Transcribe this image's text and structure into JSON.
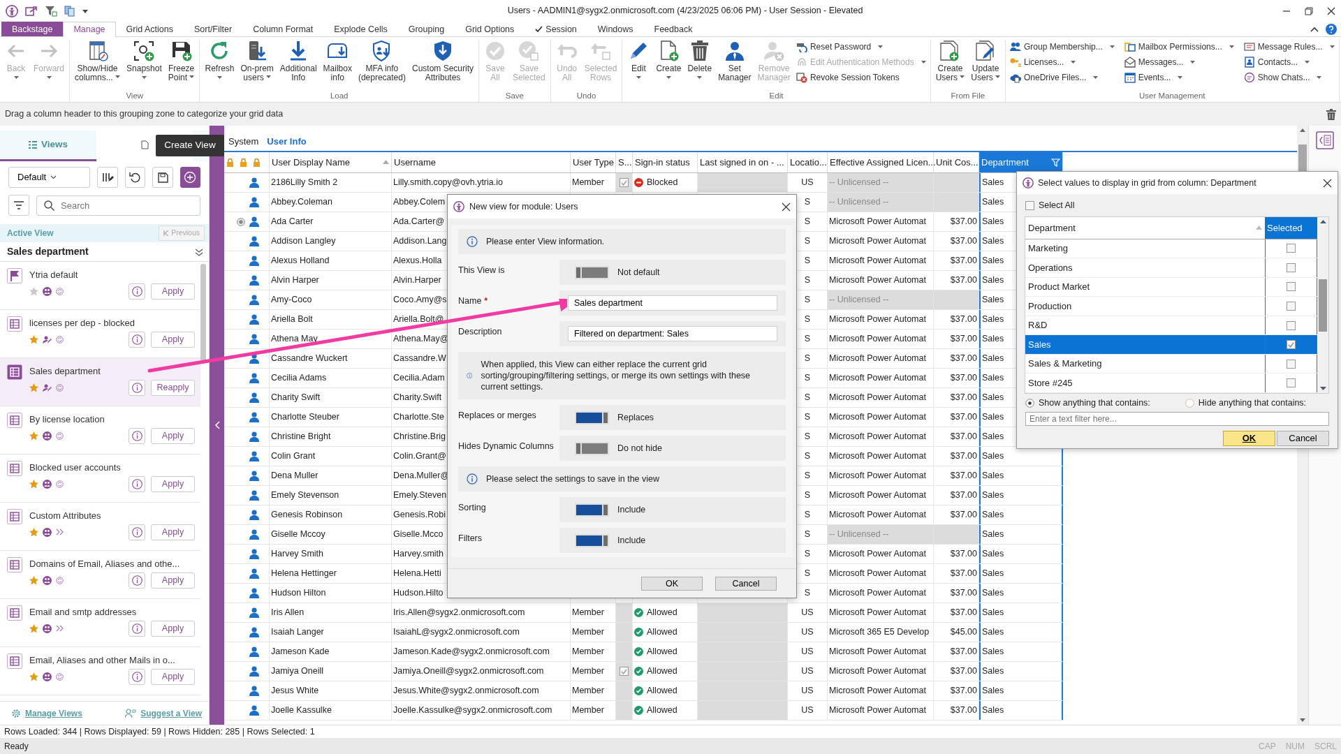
{
  "title_bar": {
    "title": "Users - AADMIN1@sygx2.onmicrosoft.com (4/23/2025 06:06 PM) - User Session - Elevated"
  },
  "menu_tabs": [
    {
      "label": "Backstage",
      "kind": "backstage",
      "selected": false,
      "checked": false
    },
    {
      "label": "Manage",
      "kind": "tab",
      "selected": true,
      "checked": false
    },
    {
      "label": "Grid Actions",
      "kind": "tab",
      "selected": false,
      "checked": false
    },
    {
      "label": "Sort/Filter",
      "kind": "tab",
      "selected": false,
      "checked": false
    },
    {
      "label": "Column Format",
      "kind": "tab",
      "selected": false,
      "checked": false
    },
    {
      "label": "Explode Cells",
      "kind": "tab",
      "selected": false,
      "checked": false
    },
    {
      "label": "Grouping",
      "kind": "tab",
      "selected": false,
      "checked": false
    },
    {
      "label": "Grid Options",
      "kind": "tab",
      "selected": false,
      "checked": false
    },
    {
      "label": "Session",
      "kind": "tab",
      "selected": false,
      "checked": true
    },
    {
      "label": "Windows",
      "kind": "tab",
      "selected": false,
      "checked": false
    },
    {
      "label": "Feedback",
      "kind": "tab",
      "selected": false,
      "checked": false
    }
  ],
  "ribbon": {
    "groups": [
      {
        "buttons": [
          {
            "lines": [
              "Back"
            ],
            "menu": true,
            "disabled": true
          },
          {
            "lines": [
              "Forward"
            ],
            "menu": true,
            "disabled": true
          }
        ]
      },
      {
        "label": "View",
        "buttons": [
          {
            "lines": [
              "Show/Hide",
              "columns..."
            ],
            "menu": true,
            "disabled": false
          },
          {
            "lines": [
              "Snapshot"
            ],
            "menu": true,
            "disabled": false
          },
          {
            "lines": [
              "Freeze",
              "Point"
            ],
            "menu": true,
            "disabled": false
          }
        ]
      },
      {
        "label": "Load",
        "buttons": [
          {
            "lines": [
              "Refresh"
            ],
            "menu": true,
            "disabled": false
          },
          {
            "lines": [
              "On-prem",
              "users"
            ],
            "menu": true,
            "disabled": false
          },
          {
            "lines": [
              "Additional",
              "Info"
            ],
            "menu": false,
            "disabled": false
          },
          {
            "lines": [
              "Mailbox",
              "info"
            ],
            "menu": false,
            "disabled": false
          },
          {
            "lines": [
              "MFA info",
              "(deprecated)"
            ],
            "menu": false,
            "disabled": false
          },
          {
            "lines": [
              "Custom Security",
              "Attributes"
            ],
            "menu": false,
            "disabled": false
          }
        ]
      },
      {
        "label": "Save",
        "buttons": [
          {
            "lines": [
              "Save",
              "All"
            ],
            "menu": false,
            "disabled": true
          },
          {
            "lines": [
              "Save",
              "Selected"
            ],
            "menu": false,
            "disabled": true
          }
        ]
      },
      {
        "label": "Undo",
        "buttons": [
          {
            "lines": [
              "Undo",
              "All"
            ],
            "menu": false,
            "disabled": true
          },
          {
            "lines": [
              "Selected",
              "Rows"
            ],
            "menu": false,
            "disabled": true
          }
        ]
      },
      {
        "label": "Edit",
        "buttons": [
          {
            "lines": [
              "Edit"
            ],
            "menu": true,
            "disabled": false
          },
          {
            "lines": [
              "Create"
            ],
            "menu": true,
            "disabled": false
          },
          {
            "lines": [
              "Delete"
            ],
            "menu": true,
            "disabled": false
          },
          {
            "lines": [
              "Set",
              "Manager"
            ],
            "menu": false,
            "disabled": false
          },
          {
            "lines": [
              "Remove",
              "Manager"
            ],
            "menu": false,
            "disabled": true
          }
        ],
        "small": [
          {
            "label": "Reset Password",
            "menu": true,
            "disabled": false
          },
          {
            "label": "Edit Authentication Methods",
            "menu": true,
            "disabled": true
          },
          {
            "label": "Revoke Session Tokens",
            "menu": false,
            "disabled": false
          }
        ]
      },
      {
        "label": "From File",
        "buttons": [
          {
            "lines": [
              "Create",
              "Users"
            ],
            "menu": true,
            "disabled": false
          },
          {
            "lines": [
              "Update",
              "Users"
            ],
            "menu": true,
            "disabled": false
          }
        ]
      },
      {
        "label": "User Management",
        "small": [
          {
            "label": "Group Membership...",
            "menu": true,
            "disabled": false
          },
          {
            "label": "Licenses...",
            "menu": true,
            "disabled": false
          },
          {
            "label": "OneDrive Files...",
            "menu": true,
            "disabled": false
          },
          {
            "label": "Mailbox Permissions...",
            "menu": true,
            "disabled": false
          },
          {
            "label": "Messages...",
            "menu": true,
            "disabled": false
          },
          {
            "label": "Events...",
            "menu": true,
            "disabled": false
          },
          {
            "label": "Message Rules...",
            "menu": true,
            "disabled": false
          },
          {
            "label": "Contacts...",
            "menu": true,
            "disabled": false
          },
          {
            "label": "Show Chats...",
            "menu": true,
            "disabled": false
          }
        ]
      }
    ]
  },
  "grouping_zone": {
    "text": "Drag a column header to this grouping zone to categorize your grid data"
  },
  "views_panel": {
    "tabs": [
      {
        "label": "Views",
        "selected": true
      },
      {
        "selected": false
      }
    ],
    "view_selector": "Default",
    "search_placeholder": "Search",
    "active_view_label": "Active View",
    "previous_button": {
      "label": "Previous",
      "disabled": true
    },
    "active_view": "Sales department",
    "items": [
      {
        "title": "Ytria default",
        "kind": "system",
        "favorite": false,
        "shared": true,
        "synced": true,
        "button": "Apply",
        "selected": false
      },
      {
        "title": "licenses per dep - blocked",
        "kind": "custom",
        "favorite": true,
        "shared": false,
        "synced": true,
        "button": "Apply",
        "selected": false
      },
      {
        "title": "Sales department",
        "kind": "custom",
        "favorite": true,
        "shared": false,
        "synced": true,
        "button": "Reapply",
        "selected": true
      },
      {
        "title": "By license location",
        "kind": "custom",
        "favorite": true,
        "shared": true,
        "synced": true,
        "button": "Apply",
        "selected": false
      },
      {
        "title": "Blocked user accounts",
        "kind": "custom",
        "favorite": true,
        "shared": true,
        "synced": true,
        "button": "Apply",
        "selected": false
      },
      {
        "title": "Custom Attributes",
        "kind": "custom",
        "favorite": true,
        "shared": true,
        "synced": false,
        "button": "Apply",
        "selected": false
      },
      {
        "title": "Domains of Email, Aliases and othe...",
        "kind": "custom",
        "favorite": true,
        "shared": true,
        "synced": true,
        "button": "Apply",
        "selected": false
      },
      {
        "title": "Email and smtp addresses",
        "kind": "custom",
        "favorite": true,
        "shared": true,
        "synced": false,
        "button": "Apply",
        "selected": false
      },
      {
        "title": "Email, Aliases and other Mails in o...",
        "kind": "custom",
        "favorite": true,
        "shared": true,
        "synced": true,
        "button": "Apply",
        "selected": false
      }
    ],
    "footer": [
      "Manage Views",
      "Suggest a View"
    ]
  },
  "tooltip": {
    "text": "Create View"
  },
  "grid": {
    "tabs": [
      {
        "label": "System",
        "selected": false
      },
      {
        "label": "User Info",
        "selected": true
      }
    ],
    "columns": [
      {
        "label": "User Display Name",
        "sorted": true,
        "filtered": false
      },
      {
        "label": "Username",
        "sorted": false,
        "filtered": false
      },
      {
        "label": "User Type",
        "sorted": false,
        "filtered": false
      },
      {
        "label": "S...",
        "sorted": false,
        "filtered": false
      },
      {
        "label": "Sign-in status",
        "sorted": false,
        "filtered": false
      },
      {
        "label": "Last signed in on - ...",
        "sorted": false,
        "filtered": false
      },
      {
        "label": "Locatio...",
        "sorted": false,
        "filtered": false
      },
      {
        "label": "Effective Assigned Licen...",
        "sorted": false,
        "filtered": false
      },
      {
        "label": "Unit Cos...",
        "sorted": false,
        "filtered": false
      },
      {
        "label": "Department",
        "sorted": false,
        "filtered": true
      }
    ],
    "rows": [
      {
        "name": "2186Lilly Smith 2",
        "username": "Lilly.smith.copy@ovh.ytria.io",
        "user_type": "Member",
        "s_checked": true,
        "sign_in": "Blocked",
        "blocked": true,
        "location": "US",
        "license": "-- Unlicensed --",
        "unlicensed": true,
        "department": "Sales",
        "selected": false
      },
      {
        "name": "Abbey.Coleman",
        "username": "Abbey.Colem",
        "location": "S",
        "license": "-- Unlicensed --",
        "unlicensed": true,
        "department": "Sales",
        "selected": false
      },
      {
        "name": "Ada Carter",
        "username": "Ada.Carter@",
        "location": "S",
        "license": "Microsoft Power Automat",
        "unit_cost": "$37.00",
        "unlicensed": false,
        "department": "Sales",
        "selected": true
      },
      {
        "name": "Addison Langley",
        "username": "Addison.Lang",
        "location": "S",
        "license": "Microsoft Power Automat",
        "unit_cost": "$37.00",
        "unlicensed": false,
        "department": "Sales",
        "selected": false
      },
      {
        "name": "Alexus Holland",
        "username": "Alexus.Holla",
        "location": "S",
        "license": "Microsoft Power Automat",
        "unit_cost": "$37.00",
        "unlicensed": false,
        "department": "Sales",
        "selected": false
      },
      {
        "name": "Alvin Harper",
        "username": "Alvin.Harper",
        "location": "S",
        "license": "Microsoft Power Automat",
        "unit_cost": "$37.00",
        "unlicensed": false,
        "department": "Sales",
        "selected": false
      },
      {
        "name": "Amy-Coco",
        "username": "Coco.Amy@s",
        "location": "S",
        "license": "-- Unlicensed --",
        "unlicensed": true,
        "department": "Sales",
        "selected": false
      },
      {
        "name": "Ariella Bolt",
        "username": "Ariella.Bolt@",
        "location": "S",
        "license": "Microsoft Power Automat",
        "unit_cost": "$37.00",
        "unlicensed": false,
        "department": "Sales",
        "selected": false
      },
      {
        "name": "Athena May",
        "username": "Athena.May@",
        "location": "S",
        "license": "Microsoft Power Automat",
        "unit_cost": "$37.00",
        "unlicensed": false,
        "department": "Sales",
        "selected": false
      },
      {
        "name": "Cassandre Wuckert",
        "username": "Cassandre.W",
        "location": "S",
        "license": "Microsoft Power Automat",
        "unit_cost": "$37.00",
        "unlicensed": false,
        "department": "Sales",
        "selected": false
      },
      {
        "name": "Cecilia Adams",
        "username": "Cecilia.Adam",
        "location": "S",
        "license": "Microsoft Power Automat",
        "unit_cost": "$37.00",
        "unlicensed": false,
        "department": "Sales",
        "selected": false
      },
      {
        "name": "Charity Swift",
        "username": "Charity.Swift",
        "location": "S",
        "license": "Microsoft Power Automat",
        "unit_cost": "$37.00",
        "unlicensed": false,
        "department": "Sales",
        "selected": false
      },
      {
        "name": "Charlotte Steuber",
        "username": "Charlotte.Ste",
        "location": "S",
        "license": "Microsoft Power Automat",
        "unit_cost": "$37.00",
        "unlicensed": false,
        "department": "Sales",
        "selected": false
      },
      {
        "name": "Christine Bright",
        "username": "Christine.Brig",
        "location": "S",
        "license": "Microsoft Power Automat",
        "unit_cost": "$37.00",
        "unlicensed": false,
        "department": "Sales",
        "selected": false
      },
      {
        "name": "Colin Grant",
        "username": "Colin.Grant@",
        "location": "S",
        "license": "Microsoft Power Automat",
        "unit_cost": "$37.00",
        "unlicensed": false,
        "department": "Sales",
        "selected": false
      },
      {
        "name": "Dena Muller",
        "username": "Dena.Muller@",
        "location": "S",
        "license": "Microsoft Power Automat",
        "unit_cost": "$37.00",
        "unlicensed": false,
        "department": "Sales",
        "selected": false
      },
      {
        "name": "Emely Stevenson",
        "username": "Emely.Steven",
        "location": "S",
        "license": "Microsoft Power Automat",
        "unit_cost": "$37.00",
        "unlicensed": false,
        "department": "Sales",
        "selected": false
      },
      {
        "name": "Genesis Robinson",
        "username": "Genesis.Robi",
        "location": "S",
        "license": "Microsoft Power Automat",
        "unit_cost": "$37.00",
        "unlicensed": false,
        "department": "Sales",
        "selected": false
      },
      {
        "name": "Giselle Mccoy",
        "username": "Giselle.Mcco",
        "location": "S",
        "license": "-- Unlicensed --",
        "unlicensed": true,
        "department": "Sales",
        "selected": false
      },
      {
        "name": "Harvey Smith",
        "username": "Harvey.smith",
        "location": "S",
        "license": "Microsoft Power Automat",
        "unit_cost": "$37.00",
        "unlicensed": false,
        "department": "Sales",
        "selected": false
      },
      {
        "name": "Helena Hettinger",
        "username": "Helena.Hetti",
        "location": "S",
        "license": "Microsoft Power Automat",
        "unit_cost": "$37.00",
        "unlicensed": false,
        "department": "Sales",
        "selected": false
      },
      {
        "name": "Hudson Hilton",
        "username": "Hudson.Hilto",
        "location": "S",
        "license": "Microsoft Power Automat",
        "unit_cost": "$37.00",
        "unlicensed": false,
        "department": "Sales",
        "selected": false
      },
      {
        "name": "Iris Allen",
        "username": "Iris.Allen@sygx2.onmicrosoft.com",
        "user_type": "Member",
        "s_checked": false,
        "sign_in": "Allowed",
        "blocked": false,
        "location": "US",
        "license": "Microsoft Power Automat",
        "unit_cost": "$37.00",
        "unlicensed": false,
        "department": "Sales",
        "selected": false
      },
      {
        "name": "Isaiah Langer",
        "username": "IsaiahL@sygx2.onmicrosoft.com",
        "user_type": "Member",
        "s_checked": false,
        "sign_in": "Allowed",
        "blocked": false,
        "location": "US",
        "license": "Microsoft 365 E5 Develop",
        "unit_cost": "$45.00",
        "unlicensed": false,
        "department": "Sales",
        "selected": false
      },
      {
        "name": "Jameson Kade",
        "username": "Jameson.Kade@sygx2.onmicrosoft.com",
        "user_type": "Member",
        "s_checked": false,
        "sign_in": "Allowed",
        "blocked": false,
        "location": "US",
        "license": "Microsoft Power Automat",
        "unit_cost": "$37.00",
        "unlicensed": false,
        "department": "Sales",
        "selected": false
      },
      {
        "name": "Jamiya Oneill",
        "username": "Jamiya.Oneill@sygx2.onmicrosoft.com",
        "user_type": "Member",
        "s_checked": true,
        "sign_in": "Allowed",
        "blocked": false,
        "location": "US",
        "license": "Microsoft Power Automat",
        "unit_cost": "$37.00",
        "unlicensed": false,
        "department": "Sales",
        "selected": false
      },
      {
        "name": "Jesus White",
        "username": "Jesus.White@sygx2.onmicrosoft.com",
        "user_type": "Member",
        "s_checked": false,
        "sign_in": "Allowed",
        "blocked": false,
        "location": "US",
        "license": "Microsoft Power Automat",
        "unit_cost": "$37.00",
        "unlicensed": false,
        "department": "Sales",
        "selected": false
      },
      {
        "name": "Joelle Kassulke",
        "username": "Joelle.Kassulke@sygx2.onmicrosoft.com",
        "user_type": "Member",
        "s_checked": false,
        "sign_in": "Allowed",
        "blocked": false,
        "location": "US",
        "license": "Microsoft Power Automat",
        "unit_cost": "$37.00",
        "unlicensed": false,
        "department": "Sales",
        "selected": false
      }
    ]
  },
  "dialog": {
    "title": "New view for module: Users",
    "sections": [
      {
        "kind": "info",
        "text": "Please enter View information."
      },
      {
        "kind": "toggle",
        "label": "This View is",
        "on": false,
        "value": "Not default"
      },
      {
        "kind": "input",
        "label": "Name",
        "required_mark": "*",
        "value": "Sales department"
      },
      {
        "kind": "input",
        "label": "Description",
        "value": "Filtered on department: Sales"
      },
      {
        "kind": "info",
        "text": "When applied, this View can either replace the current grid sorting/grouping/filtering settings, or merge its own settings with these current settings."
      },
      {
        "kind": "toggle",
        "label": "Replaces or merges",
        "on": true,
        "value": "Replaces"
      },
      {
        "kind": "toggle",
        "label": "Hides Dynamic Columns",
        "on": false,
        "value": "Do not hide"
      },
      {
        "kind": "info",
        "text": "Please select the settings to save in the view"
      },
      {
        "kind": "toggle",
        "label": "Sorting",
        "on": true,
        "value": "Include"
      },
      {
        "kind": "toggle",
        "label": "Filters",
        "on": true,
        "value": "Include"
      }
    ],
    "buttons": [
      "OK",
      "Cancel"
    ]
  },
  "filter_popup": {
    "title": "Select values to display in grid from column: Department",
    "select_all": {
      "label": "Select All",
      "checked": false
    },
    "columns": [
      "Department",
      "Selected"
    ],
    "values": [
      {
        "label": "Marketing",
        "selected": false,
        "checked": false
      },
      {
        "label": "Operations",
        "selected": false,
        "checked": false
      },
      {
        "label": "Product Market",
        "selected": false,
        "checked": false
      },
      {
        "label": "Production",
        "selected": false,
        "checked": false
      },
      {
        "label": "R&D",
        "selected": false,
        "checked": false
      },
      {
        "label": "Sales",
        "selected": true,
        "checked": true
      },
      {
        "label": "Sales & Marketing",
        "selected": false,
        "checked": false
      },
      {
        "label": "Store #245",
        "selected": false,
        "checked": false
      }
    ],
    "match_options": [
      {
        "label": "Show anything that contains:",
        "selected": true
      },
      {
        "label": "Hide anything that contains:",
        "selected": false
      }
    ],
    "filter_placeholder": "Enter a text filter here...",
    "buttons": [
      {
        "label": "OK",
        "kind": "default"
      },
      {
        "label": "Cancel",
        "kind": "normal"
      }
    ]
  },
  "status_bar": {
    "summary": "Rows Loaded: 344 | Rows Displayed: 59 | Rows Hidden: 285 | Rows Selected: 1",
    "state": "Ready",
    "indicators": [
      {
        "label": "CAP",
        "on": false
      },
      {
        "label": "NUM",
        "on": false
      },
      {
        "label": "SCRL",
        "on": false
      }
    ]
  }
}
